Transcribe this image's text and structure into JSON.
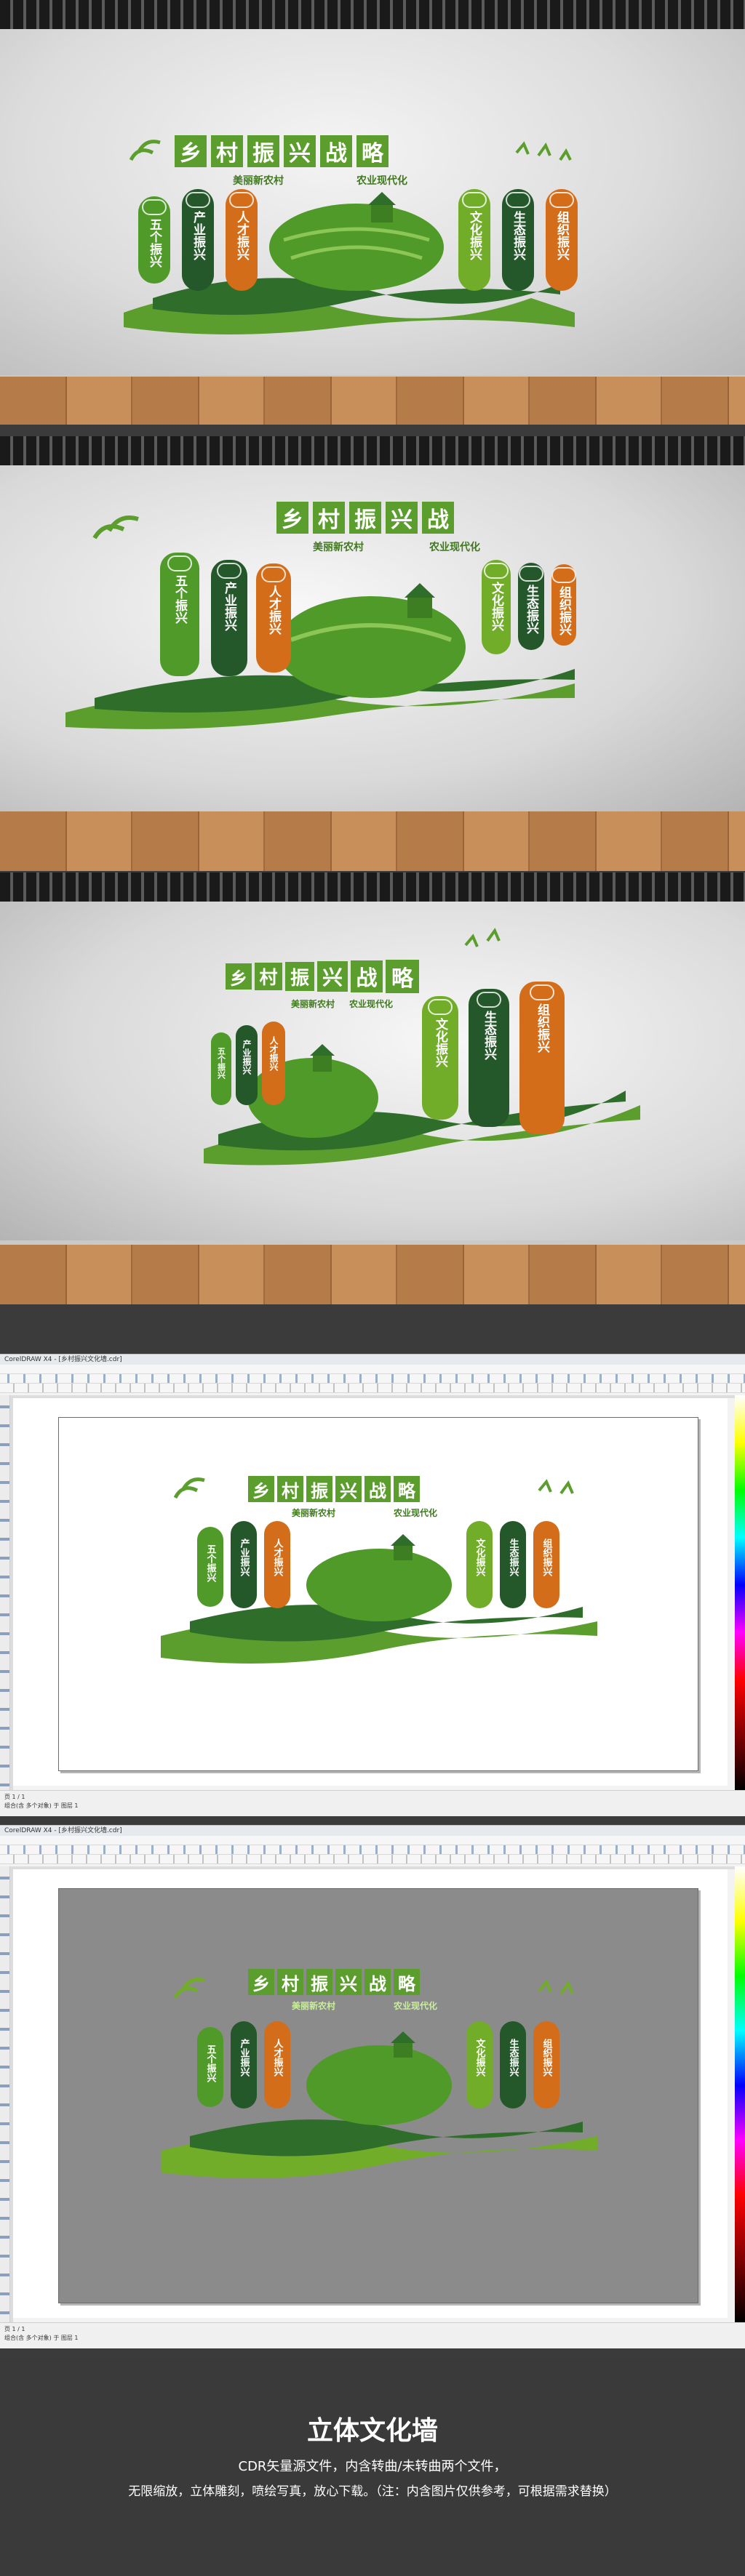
{
  "wall": {
    "title_chars": [
      "乡",
      "村",
      "振",
      "兴",
      "战",
      "略"
    ],
    "subtitle_left": "美丽新农村",
    "subtitle_right": "农业现代化",
    "pills": [
      {
        "text": "五个振兴",
        "color": "green"
      },
      {
        "text": "产业振兴",
        "color": "dgreen"
      },
      {
        "text": "人才振兴",
        "color": "orange"
      },
      {
        "text": "文化振兴",
        "color": "lgreen"
      },
      {
        "text": "生态振兴",
        "color": "dgreen"
      },
      {
        "text": "组织振兴",
        "color": "orange"
      }
    ]
  },
  "software": {
    "title": "CorelDRAW X4 - [乡村振兴文化墙.cdr]",
    "status_line1": "页 1 / 1",
    "status_line2": "组合(含 多个对象) 于 图层 1"
  },
  "footer": {
    "title": "立体文化墙",
    "line1": "CDR矢量源文件，内含转曲/未转曲两个文件，",
    "line2": "无限缩放，立体雕刻，喷绘写真，放心下载。（注：内含图片仅供参考，可根据需求替换）"
  },
  "colors": {
    "green": "#4f9a28",
    "dark_green": "#24572a",
    "orange": "#d46d1a",
    "light_green": "#72ad2a"
  }
}
